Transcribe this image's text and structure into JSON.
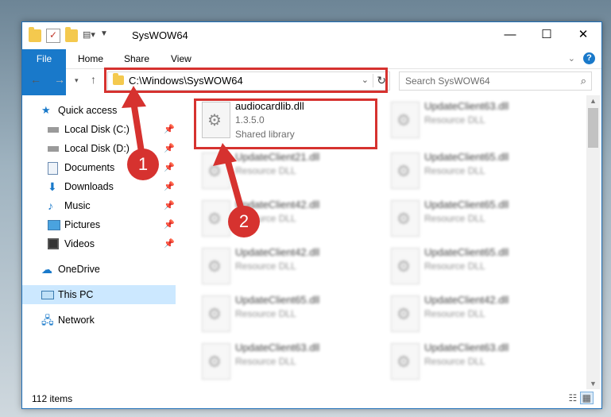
{
  "window": {
    "title": "SysWOW64",
    "controls": {
      "minimize": "—",
      "maximize": "☐",
      "close": "✕"
    }
  },
  "ribbon": {
    "tabs": [
      "File",
      "Home",
      "Share",
      "View"
    ]
  },
  "nav": {
    "address": "C:\\Windows\\SysWOW64",
    "search_placeholder": "Search SysWOW64"
  },
  "sidebar": {
    "items": [
      {
        "label": "Quick access",
        "icon": "star-icon"
      },
      {
        "label": "Local Disk (C:)",
        "icon": "drive-icon",
        "pinned": true
      },
      {
        "label": "Local Disk (D:)",
        "icon": "drive-icon",
        "pinned": true
      },
      {
        "label": "Documents",
        "icon": "documents-icon",
        "pinned": true
      },
      {
        "label": "Downloads",
        "icon": "download-icon",
        "pinned": true
      },
      {
        "label": "Music",
        "icon": "music-icon",
        "pinned": true
      },
      {
        "label": "Pictures",
        "icon": "pictures-icon",
        "pinned": true
      },
      {
        "label": "Videos",
        "icon": "videos-icon",
        "pinned": true
      },
      {
        "label": "OneDrive",
        "icon": "cloud-icon"
      },
      {
        "label": "This PC",
        "icon": "computer-icon",
        "selected": true
      },
      {
        "label": "Network",
        "icon": "network-icon"
      }
    ]
  },
  "files": [
    {
      "name": "audiocardlib.dll",
      "version": "1.3.5.0",
      "desc": "Shared library",
      "clear": true
    },
    {
      "name": "UpdateClient63.dll",
      "desc": "Resource DLL"
    },
    {
      "name": "UpdateClient21.dll",
      "desc": "Resource DLL"
    },
    {
      "name": "UpdateClient65.dll",
      "desc": "Resource DLL"
    },
    {
      "name": "UpdateClient42.dll",
      "desc": "Resource DLL"
    },
    {
      "name": "UpdateClient65.dll",
      "desc": "Resource DLL"
    },
    {
      "name": "UpdateClient42.dll",
      "desc": "Resource DLL"
    },
    {
      "name": "UpdateClient65.dll",
      "desc": "Resource DLL"
    },
    {
      "name": "UpdateClient65.dll",
      "desc": "Resource DLL"
    },
    {
      "name": "UpdateClient42.dll",
      "desc": "Resource DLL"
    },
    {
      "name": "UpdateClient63.dll",
      "desc": "Resource DLL"
    },
    {
      "name": "UpdateClient63.dll",
      "desc": "Resource DLL"
    }
  ],
  "status": {
    "count": "112 items"
  },
  "annotations": {
    "badge1": "1",
    "badge2": "2"
  },
  "colors": {
    "accent": "#1979ca",
    "highlight": "#d6322f"
  }
}
